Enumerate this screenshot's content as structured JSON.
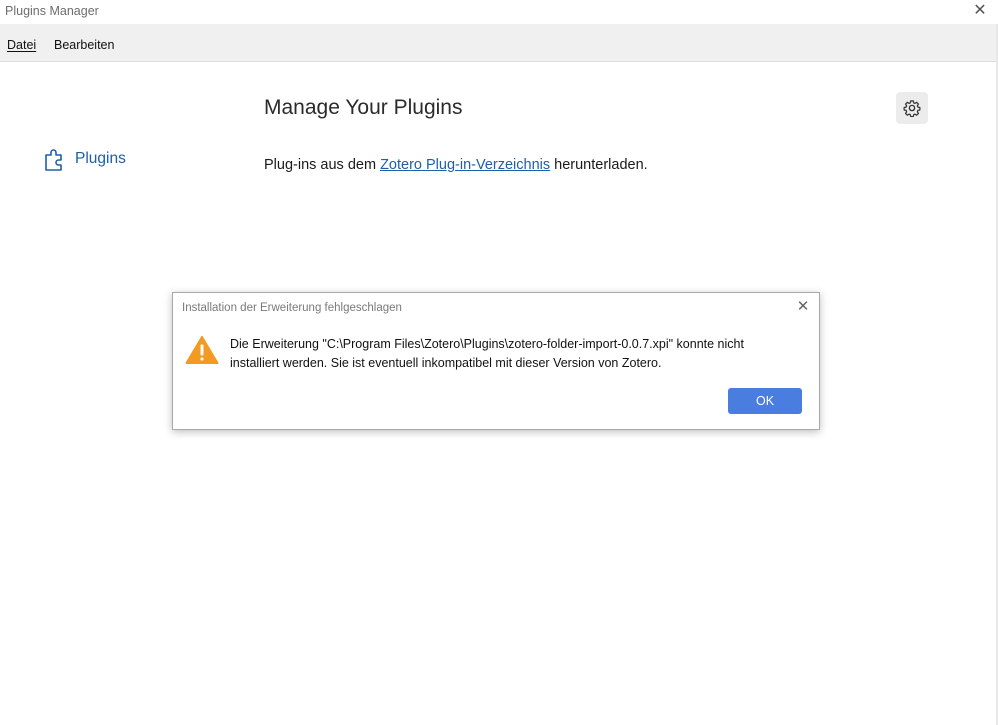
{
  "window": {
    "title": "Plugins Manager",
    "close_glyph": "✕"
  },
  "menubar": {
    "items": [
      {
        "label": "Datei",
        "access_key": "D"
      },
      {
        "label": "Bearbeiten",
        "access_key": "B"
      }
    ]
  },
  "sidebar": {
    "items": [
      {
        "label": "Plugins",
        "icon": "puzzle-icon",
        "selected": true
      }
    ]
  },
  "main": {
    "title": "Manage Your Plugins",
    "settings_icon": "gear-icon",
    "info_prefix": "Plug-ins aus dem ",
    "info_link": "Zotero Plug-in-Verzeichnis",
    "info_suffix": " herunterladen."
  },
  "dialog": {
    "title": "Installation der Erweiterung fehlgeschlagen",
    "icon": "warning-icon",
    "message_line1": "Die Erweiterung \"C:\\Program Files\\Zotero\\Plugins\\zotero-folder-import-0.0.7.xpi\" konnte nicht",
    "message_line2": "installiert werden. Sie ist eventuell inkompatibel mit dieser Version von Zotero.",
    "ok_label": "OK",
    "close_glyph": "✕"
  },
  "colors": {
    "accent_link": "#1d5fa8",
    "ok_button": "#4a7de0",
    "warning": "#f39a23"
  }
}
